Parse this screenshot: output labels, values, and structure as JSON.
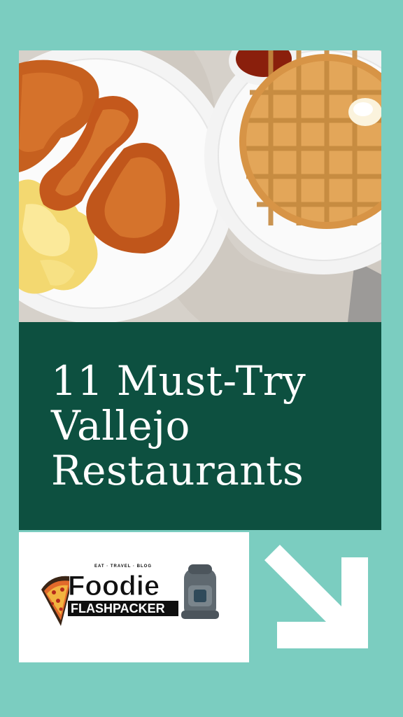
{
  "pin": {
    "title_lines": [
      "11 Must-Try",
      "Vallejo",
      "Restaurants"
    ],
    "image_description_icon": "fried-chicken-and-waffles-photo"
  },
  "logo": {
    "tagline": "EAT · TRAVEL · BLOG",
    "name_line1": "Foodie",
    "name_line2": "FLASHPACKER"
  },
  "colors": {
    "background": "#7bcdc0",
    "title_panel": "#0d5040",
    "arrow": "#ffffff"
  },
  "icons": {
    "arrow": "arrow-down-right-icon",
    "pizza": "pizza-icon",
    "backpack": "backpack-icon"
  }
}
